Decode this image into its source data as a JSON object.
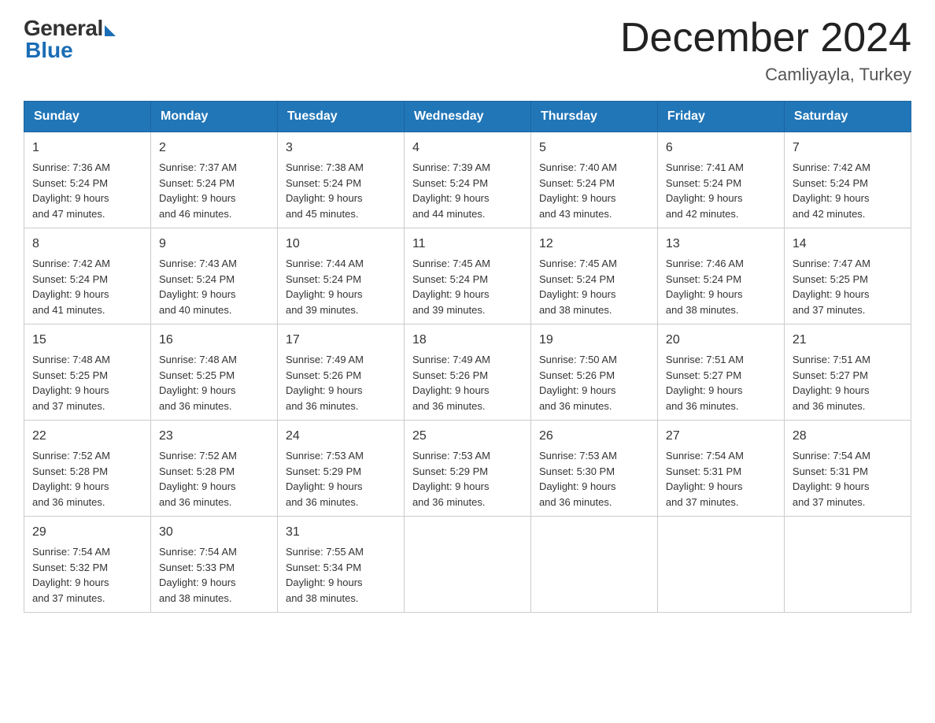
{
  "header": {
    "logo_general": "General",
    "logo_blue": "Blue",
    "month_title": "December 2024",
    "location": "Camliyayla, Turkey"
  },
  "days_of_week": [
    "Sunday",
    "Monday",
    "Tuesday",
    "Wednesday",
    "Thursday",
    "Friday",
    "Saturday"
  ],
  "weeks": [
    [
      {
        "day": "1",
        "sunrise": "7:36 AM",
        "sunset": "5:24 PM",
        "daylight": "9 hours and 47 minutes."
      },
      {
        "day": "2",
        "sunrise": "7:37 AM",
        "sunset": "5:24 PM",
        "daylight": "9 hours and 46 minutes."
      },
      {
        "day": "3",
        "sunrise": "7:38 AM",
        "sunset": "5:24 PM",
        "daylight": "9 hours and 45 minutes."
      },
      {
        "day": "4",
        "sunrise": "7:39 AM",
        "sunset": "5:24 PM",
        "daylight": "9 hours and 44 minutes."
      },
      {
        "day": "5",
        "sunrise": "7:40 AM",
        "sunset": "5:24 PM",
        "daylight": "9 hours and 43 minutes."
      },
      {
        "day": "6",
        "sunrise": "7:41 AM",
        "sunset": "5:24 PM",
        "daylight": "9 hours and 42 minutes."
      },
      {
        "day": "7",
        "sunrise": "7:42 AM",
        "sunset": "5:24 PM",
        "daylight": "9 hours and 42 minutes."
      }
    ],
    [
      {
        "day": "8",
        "sunrise": "7:42 AM",
        "sunset": "5:24 PM",
        "daylight": "9 hours and 41 minutes."
      },
      {
        "day": "9",
        "sunrise": "7:43 AM",
        "sunset": "5:24 PM",
        "daylight": "9 hours and 40 minutes."
      },
      {
        "day": "10",
        "sunrise": "7:44 AM",
        "sunset": "5:24 PM",
        "daylight": "9 hours and 39 minutes."
      },
      {
        "day": "11",
        "sunrise": "7:45 AM",
        "sunset": "5:24 PM",
        "daylight": "9 hours and 39 minutes."
      },
      {
        "day": "12",
        "sunrise": "7:45 AM",
        "sunset": "5:24 PM",
        "daylight": "9 hours and 38 minutes."
      },
      {
        "day": "13",
        "sunrise": "7:46 AM",
        "sunset": "5:24 PM",
        "daylight": "9 hours and 38 minutes."
      },
      {
        "day": "14",
        "sunrise": "7:47 AM",
        "sunset": "5:25 PM",
        "daylight": "9 hours and 37 minutes."
      }
    ],
    [
      {
        "day": "15",
        "sunrise": "7:48 AM",
        "sunset": "5:25 PM",
        "daylight": "9 hours and 37 minutes."
      },
      {
        "day": "16",
        "sunrise": "7:48 AM",
        "sunset": "5:25 PM",
        "daylight": "9 hours and 36 minutes."
      },
      {
        "day": "17",
        "sunrise": "7:49 AM",
        "sunset": "5:26 PM",
        "daylight": "9 hours and 36 minutes."
      },
      {
        "day": "18",
        "sunrise": "7:49 AM",
        "sunset": "5:26 PM",
        "daylight": "9 hours and 36 minutes."
      },
      {
        "day": "19",
        "sunrise": "7:50 AM",
        "sunset": "5:26 PM",
        "daylight": "9 hours and 36 minutes."
      },
      {
        "day": "20",
        "sunrise": "7:51 AM",
        "sunset": "5:27 PM",
        "daylight": "9 hours and 36 minutes."
      },
      {
        "day": "21",
        "sunrise": "7:51 AM",
        "sunset": "5:27 PM",
        "daylight": "9 hours and 36 minutes."
      }
    ],
    [
      {
        "day": "22",
        "sunrise": "7:52 AM",
        "sunset": "5:28 PM",
        "daylight": "9 hours and 36 minutes."
      },
      {
        "day": "23",
        "sunrise": "7:52 AM",
        "sunset": "5:28 PM",
        "daylight": "9 hours and 36 minutes."
      },
      {
        "day": "24",
        "sunrise": "7:53 AM",
        "sunset": "5:29 PM",
        "daylight": "9 hours and 36 minutes."
      },
      {
        "day": "25",
        "sunrise": "7:53 AM",
        "sunset": "5:29 PM",
        "daylight": "9 hours and 36 minutes."
      },
      {
        "day": "26",
        "sunrise": "7:53 AM",
        "sunset": "5:30 PM",
        "daylight": "9 hours and 36 minutes."
      },
      {
        "day": "27",
        "sunrise": "7:54 AM",
        "sunset": "5:31 PM",
        "daylight": "9 hours and 37 minutes."
      },
      {
        "day": "28",
        "sunrise": "7:54 AM",
        "sunset": "5:31 PM",
        "daylight": "9 hours and 37 minutes."
      }
    ],
    [
      {
        "day": "29",
        "sunrise": "7:54 AM",
        "sunset": "5:32 PM",
        "daylight": "9 hours and 37 minutes."
      },
      {
        "day": "30",
        "sunrise": "7:54 AM",
        "sunset": "5:33 PM",
        "daylight": "9 hours and 38 minutes."
      },
      {
        "day": "31",
        "sunrise": "7:55 AM",
        "sunset": "5:34 PM",
        "daylight": "9 hours and 38 minutes."
      },
      null,
      null,
      null,
      null
    ]
  ],
  "labels": {
    "sunrise": "Sunrise:",
    "sunset": "Sunset:",
    "daylight": "Daylight:"
  }
}
